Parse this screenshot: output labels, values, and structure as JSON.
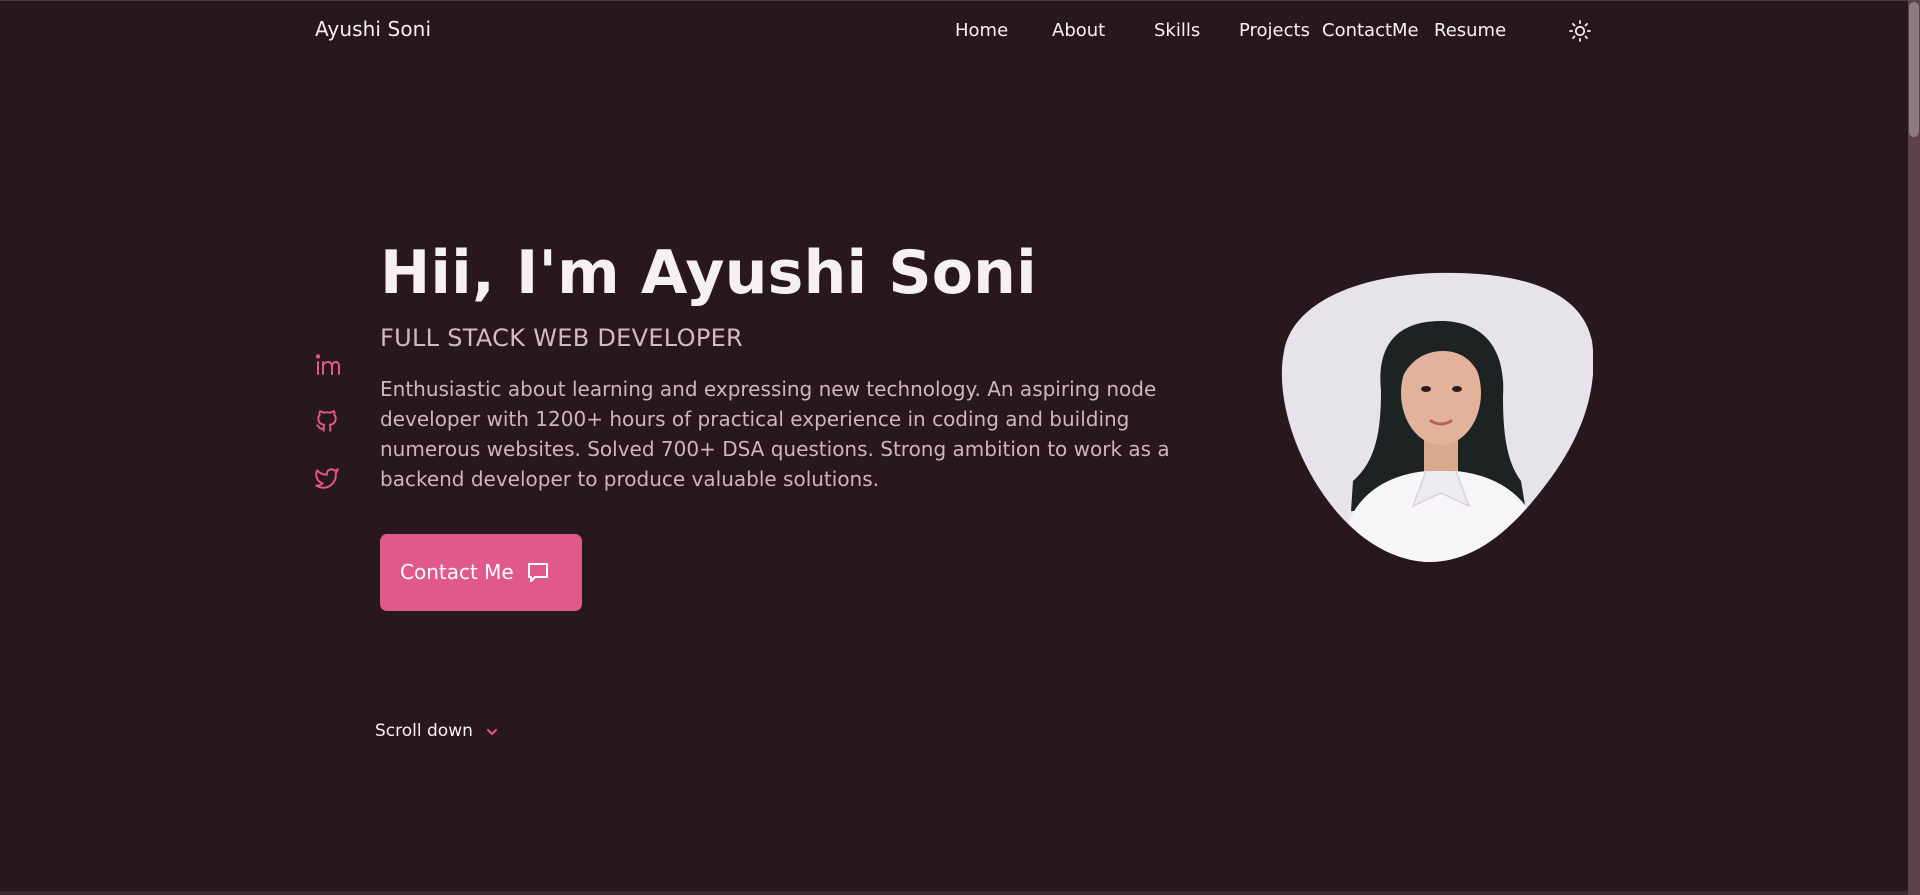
{
  "header": {
    "brand": "Ayushi Soni",
    "nav": [
      {
        "label": "Home"
      },
      {
        "label": "About"
      },
      {
        "label": "Skills"
      },
      {
        "label": "Projects"
      },
      {
        "label": "ContactMe"
      },
      {
        "label": "Resume"
      }
    ],
    "theme_toggle_icon": "sun-icon"
  },
  "social": {
    "items": [
      {
        "icon": "linkedin-icon"
      },
      {
        "icon": "github-icon"
      },
      {
        "icon": "twitter-icon"
      }
    ]
  },
  "hero": {
    "title": "Hii, I'm Ayushi Soni",
    "subtitle": "FULL STACK WEB DEVELOPER",
    "description": "Enthusiastic about learning and expressing new technology. An aspiring node developer with 1200+ hours of practical experience in coding and building numerous websites. Solved 700+ DSA questions. Strong ambition to work as a backend developer to produce valuable solutions.",
    "cta_label": "Contact Me",
    "cta_icon": "message-icon"
  },
  "scroll": {
    "label": "Scroll down",
    "icon": "chevron-down-icon"
  },
  "colors": {
    "background": "#28171c",
    "accent": "#e1588b",
    "text_primary": "#f7f0f2",
    "text_muted": "#cbb7bd"
  }
}
